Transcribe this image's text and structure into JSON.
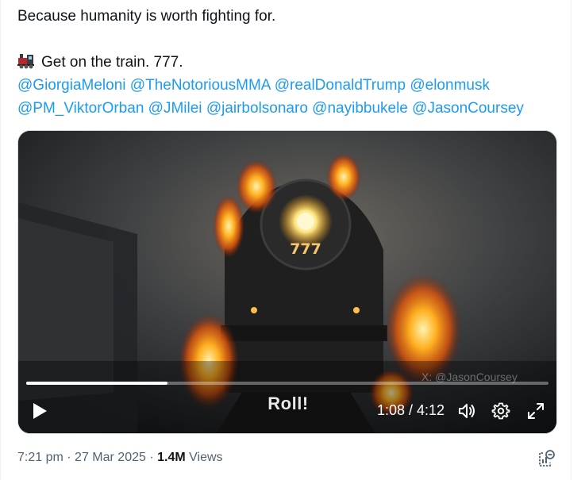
{
  "tweet": {
    "line1": "Because humanity is worth fighting for.",
    "line2_text": "Get on the train. 777.",
    "emoji_icon": "steam-locomotive-icon",
    "mentions_row1": [
      "@GiorgiaMeloni",
      "@TheNotoriousMMA",
      "@realDonaldTrump",
      "@elonmusk"
    ],
    "mentions_row2": [
      "@PM_ViktorOrban",
      "@JMilei",
      "@jairbolsonaro",
      "@nayibbukele",
      "@JasonCoursey"
    ]
  },
  "video": {
    "engine_number": "777",
    "caption": "Roll!",
    "watermark": "X: @JasonCoursey",
    "time_display": "1:08 / 4:12",
    "progress_fraction": 0.27,
    "icons": [
      "play-icon",
      "volume-icon",
      "settings-icon",
      "fullscreen-icon"
    ]
  },
  "meta": {
    "time": "7:21 pm",
    "date": "27 Mar 2025",
    "views_count": "1.4M",
    "views_label": "Views",
    "sep": "·"
  },
  "colors": {
    "link": "#1d9bf0",
    "text": "#0f1419",
    "muted": "#536471"
  }
}
